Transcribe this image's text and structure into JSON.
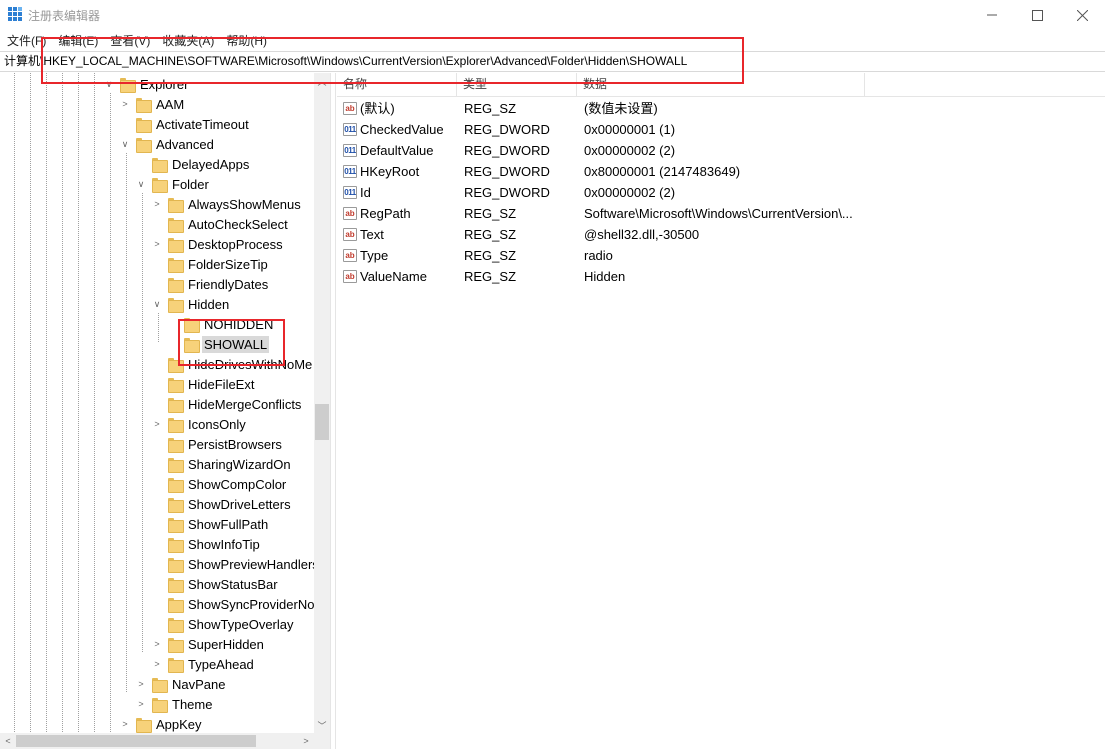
{
  "window": {
    "title": "注册表编辑器"
  },
  "menu": [
    "文件(F)",
    "编辑(E)",
    "查看(V)",
    "收藏夹(A)",
    "帮助(H)"
  ],
  "address": {
    "path": "计算机\\HKEY_LOCAL_MACHINE\\SOFTWARE\\Microsoft\\Windows\\CurrentVersion\\Explorer\\Advanced\\Folder\\Hidden\\SHOWALL"
  },
  "tree": [
    {
      "label": "Explorer",
      "arrow": "expanded"
    },
    {
      "label": "AAM",
      "arrow": "collapsed"
    },
    {
      "label": "ActivateTimeout",
      "arrow": "none"
    },
    {
      "label": "Advanced",
      "arrow": "expanded"
    },
    {
      "label": "DelayedApps",
      "arrow": "none"
    },
    {
      "label": "Folder",
      "arrow": "expanded"
    },
    {
      "label": "AlwaysShowMenus",
      "arrow": "collapsed"
    },
    {
      "label": "AutoCheckSelect",
      "arrow": "none"
    },
    {
      "label": "DesktopProcess",
      "arrow": "collapsed"
    },
    {
      "label": "FolderSizeTip",
      "arrow": "none"
    },
    {
      "label": "FriendlyDates",
      "arrow": "none"
    },
    {
      "label": "Hidden",
      "arrow": "expanded"
    },
    {
      "label": "NOHIDDEN",
      "arrow": "none"
    },
    {
      "label": "SHOWALL",
      "arrow": "none"
    },
    {
      "label": "HideDrivesWithNoMe",
      "arrow": "none"
    },
    {
      "label": "HideFileExt",
      "arrow": "none"
    },
    {
      "label": "HideMergeConflicts",
      "arrow": "none"
    },
    {
      "label": "IconsOnly",
      "arrow": "collapsed"
    },
    {
      "label": "PersistBrowsers",
      "arrow": "none"
    },
    {
      "label": "SharingWizardOn",
      "arrow": "none"
    },
    {
      "label": "ShowCompColor",
      "arrow": "none"
    },
    {
      "label": "ShowDriveLetters",
      "arrow": "none"
    },
    {
      "label": "ShowFullPath",
      "arrow": "none"
    },
    {
      "label": "ShowInfoTip",
      "arrow": "none"
    },
    {
      "label": "ShowPreviewHandlers",
      "arrow": "none"
    },
    {
      "label": "ShowStatusBar",
      "arrow": "none"
    },
    {
      "label": "ShowSyncProviderNot",
      "arrow": "none"
    },
    {
      "label": "ShowTypeOverlay",
      "arrow": "none"
    },
    {
      "label": "SuperHidden",
      "arrow": "collapsed"
    },
    {
      "label": "TypeAhead",
      "arrow": "collapsed"
    },
    {
      "label": "NavPane",
      "arrow": "collapsed"
    },
    {
      "label": "Theme",
      "arrow": "collapsed"
    },
    {
      "label": "AppKey",
      "arrow": "collapsed"
    }
  ],
  "selected_key": "SHOWALL",
  "columns": [
    "名称",
    "类型",
    "数据"
  ],
  "values": [
    {
      "icon": "ab",
      "name": "(默认)",
      "type": "REG_SZ",
      "data": "(数值未设置)"
    },
    {
      "icon": "dword",
      "name": "CheckedValue",
      "type": "REG_DWORD",
      "data": "0x00000001 (1)"
    },
    {
      "icon": "dword",
      "name": "DefaultValue",
      "type": "REG_DWORD",
      "data": "0x00000002 (2)"
    },
    {
      "icon": "dword",
      "name": "HKeyRoot",
      "type": "REG_DWORD",
      "data": "0x80000001 (2147483649)"
    },
    {
      "icon": "dword",
      "name": "Id",
      "type": "REG_DWORD",
      "data": "0x00000002 (2)"
    },
    {
      "icon": "ab",
      "name": "RegPath",
      "type": "REG_SZ",
      "data": "Software\\Microsoft\\Windows\\CurrentVersion\\..."
    },
    {
      "icon": "ab",
      "name": "Text",
      "type": "REG_SZ",
      "data": "@shell32.dll,-30500"
    },
    {
      "icon": "ab",
      "name": "Type",
      "type": "REG_SZ",
      "data": "radio"
    },
    {
      "icon": "ab",
      "name": "ValueName",
      "type": "REG_SZ",
      "data": "Hidden"
    }
  ],
  "colors": {
    "highlight": "#e8262b",
    "selection": "#d9d9d9",
    "folder": "#f7d27a"
  }
}
